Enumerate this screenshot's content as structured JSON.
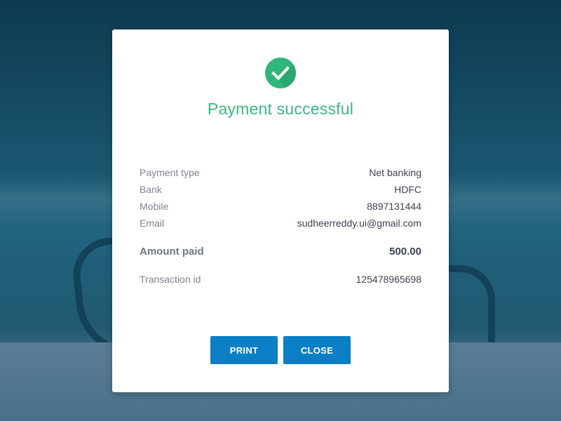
{
  "dialog": {
    "status_icon": "checkmark-circle-icon",
    "title": "Payment successful",
    "details": [
      {
        "label": "Payment type",
        "value": "Net banking"
      },
      {
        "label": "Bank",
        "value": "HDFC"
      },
      {
        "label": "Mobile",
        "value": "8897131444"
      },
      {
        "label": "Email",
        "value": "sudheerreddy.ui@gmail.com"
      }
    ],
    "amount": {
      "label": "Amount paid",
      "value": "500.00"
    },
    "transaction": {
      "label": "Transaction id",
      "value": "125478965698"
    },
    "buttons": {
      "print_label": "PRINT",
      "close_label": "CLOSE"
    }
  },
  "colors": {
    "success_green": "#2fb67a",
    "button_blue": "#0b7fc6"
  }
}
